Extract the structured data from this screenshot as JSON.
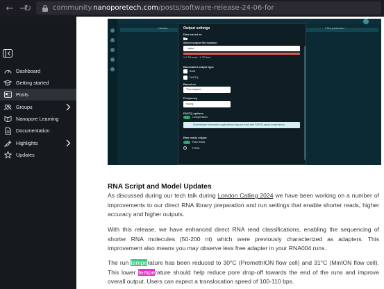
{
  "browser": {
    "url_prefix": "community.",
    "url_domain": "nanoporetech.com",
    "url_path": "/posts/software-release-24-06-for"
  },
  "sidebar": {
    "items": [
      {
        "label": "Dashboard",
        "icon": "dashboard-gauge-icon"
      },
      {
        "label": "Getting started",
        "icon": "graduation-cap-icon"
      },
      {
        "label": "Posts",
        "icon": "posts-icon",
        "active": true
      },
      {
        "label": "Groups",
        "icon": "groups-icon",
        "has_children": true
      },
      {
        "label": "Nanopore Learning",
        "icon": "learning-icon"
      },
      {
        "label": "Documentation",
        "icon": "documentation-icon"
      },
      {
        "label": "Highlights",
        "icon": "highlights-icon",
        "has_children": true
      },
      {
        "label": "Updates",
        "icon": "star-icon"
      }
    ]
  },
  "screenshot": {
    "left_tab": "Libraries",
    "right_tab": "1 Run parameters",
    "dialog": {
      "title": "Output settings",
      "data_saved_as": "Data saved as",
      "folder_value": "",
      "saved_output_location": "Saved output file location",
      "path_value": "/data/",
      "disk_note": "1.1 TB used · 4 TB free",
      "basecalled_output_type": "Basecalled output type",
      "opt_bam": "BAM",
      "opt_fastq": "FASTQ",
      "based_on": "Based on",
      "based_on_value": "Time elapsed",
      "frequency": "Frequency",
      "frequency_value": "Hourly",
      "fastq_options": "FASTQ options",
      "compression": "Compression",
      "compression_note": "Downstream informatics applications may not work with FASTQ.bgzip compression",
      "raw_reads_output": "Raw reads output",
      "raw_reads": "Raw reads",
      "pod5": "POD5"
    }
  },
  "article": {
    "heading": "RNA Script and Model Updates",
    "p1_before": "As discussed during our tech talk during ",
    "p1_link": "London Calling 2024",
    "p1_after": " we have been working on a number of improvements to our direct RNA library preparation and run settings that enable shorter reads, higher accuracy and higher outputs.",
    "p2": "With this release, we have enhanced direct RNA read classifications, enabling the sequencing of shorter RNA molecules (50-200 nt) which were previously characterized as adapters. This improvement also means you may observe less free adapter in your RNA004 runs.",
    "p3_a": "The run ",
    "p3_hl1": "tempe",
    "p3_b": "rature has been reduced to 30°C (PromethION flow cell) and 31°C (MinION flow cell). This lower ",
    "p3_hl2": "tempe",
    "p3_c": "rature should help reduce pore drop-off towards the end of the runs and improve overall output. Users can expect a translocation speed of 100-110 bps."
  },
  "colors": {
    "sidebar_bg": "#161a1f",
    "highlight_green": "#3ec982",
    "highlight_pink": "#e233c9",
    "toggle_green": "#2fa56a"
  }
}
